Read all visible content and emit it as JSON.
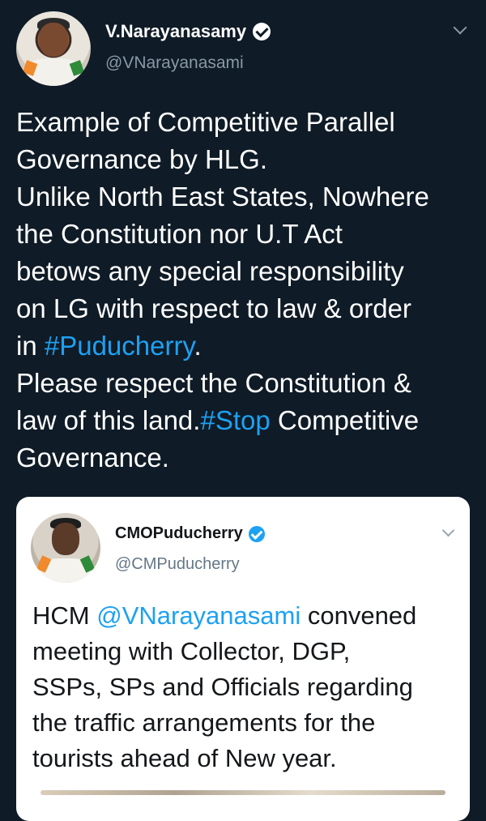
{
  "tweet": {
    "author_name": "V.Narayanasamy",
    "author_handle": "@VNarayanasami",
    "verified_icon": "verified-badge-icon",
    "menu_icon": "chevron-down-icon",
    "lines": [
      {
        "text": "Example of Competitive Parallel"
      },
      {
        "text": "Governance by HLG."
      },
      {
        "text": "Unlike North East States, Nowhere"
      },
      {
        "text": "the Constitution nor U.T Act"
      },
      {
        "text": "betows any special responsibility"
      },
      {
        "text": "on LG with respect to law & order"
      },
      {
        "pre": "in ",
        "link": "#Puducherry",
        "post": "."
      },
      {
        "text": "Please respect the Constitution &"
      },
      {
        "pre": "law of this land.",
        "link": "#Stop",
        "post": " Competitive"
      },
      {
        "text": "Governance."
      }
    ]
  },
  "quoted_tweet": {
    "author_name": "CMOPuducherry",
    "author_handle": "@CMPuducherry",
    "lines": [
      {
        "pre": "HCM ",
        "link": "@VNarayanasami",
        "post": " convened"
      },
      {
        "text": "meeting with Collector, DGP,"
      },
      {
        "text": "SSPs, SPs and Officials regarding"
      },
      {
        "text": "the traffic arrangements for the"
      },
      {
        "text": "tourists ahead of New year."
      }
    ]
  },
  "colors": {
    "background": "#0f1b26",
    "link": "#1da1f2",
    "muted": "#8899a6",
    "card": "#ffffff"
  }
}
